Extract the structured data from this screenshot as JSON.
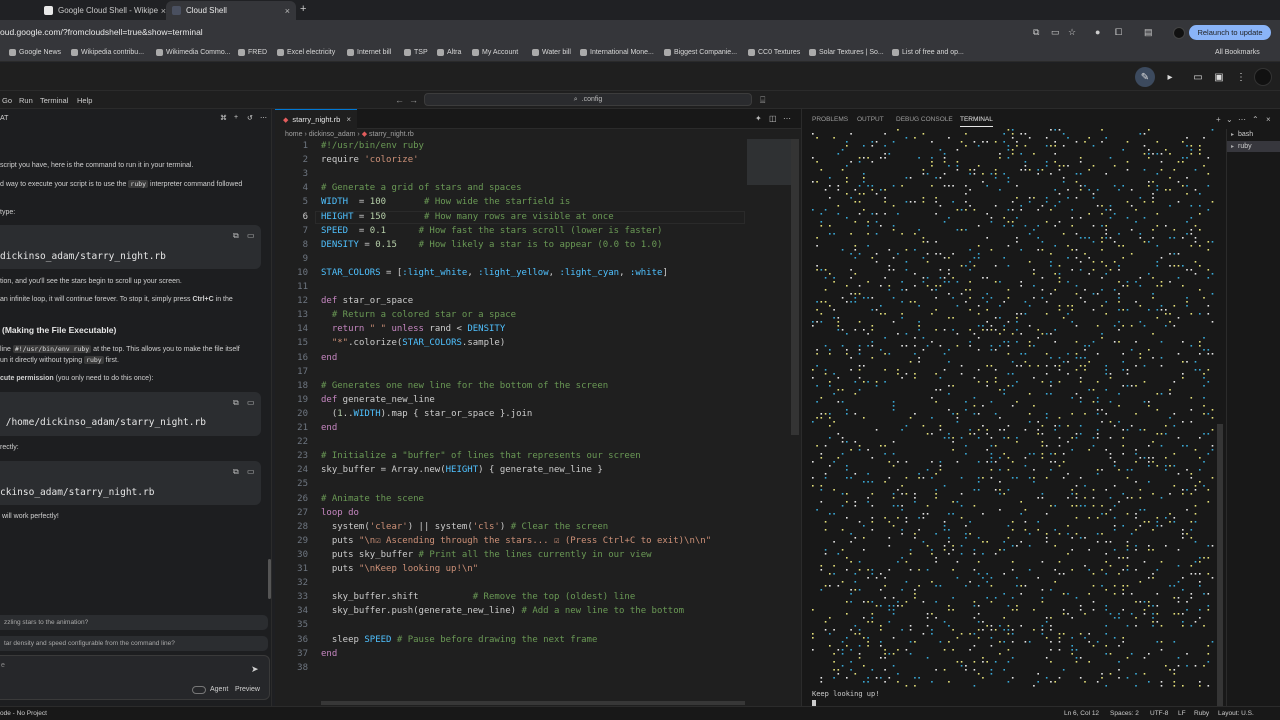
{
  "browser": {
    "tabs": [
      {
        "label": "Google Cloud Shell - Wikipe"
      },
      {
        "label": "Cloud Shell"
      }
    ],
    "url": "oud.google.com/?fromcloudshell=true&show=terminal",
    "relaunch_label": "Relaunch to update",
    "bookmarks": [
      "Google News",
      "Wikipedia contribu...",
      "Wikimedia Commo...",
      "FRED",
      "Excel electricity",
      "Internet bill",
      "TSP",
      "Altra",
      "My Account",
      "Water bill",
      "International Mone...",
      "Biggest Companie...",
      "CC0 Textures",
      "Solar Textures | So...",
      "List of free and op..."
    ],
    "all_bookmarks": "All Bookmarks"
  },
  "menubar": {
    "items": [
      "Go",
      "Run",
      "Terminal",
      "Help"
    ],
    "command_center": ".config"
  },
  "chat": {
    "header": "AT",
    "lines": [
      "script you have, here is the command to run it in your terminal.",
      "d way to execute your script is to use the",
      "interpreter command followed",
      "type:",
      "tion, and you'll see the stars begin to scroll up your screen.",
      "an infinite loop, it will continue forever. To stop it, simply press",
      "Ctrl+C",
      "in the",
      "(Making the File Executable)",
      "line",
      "at the top. This allows you to make the file itself",
      "un it directly without typing",
      "first.",
      "cute permission",
      "(you only need to do this once):",
      "rectly:",
      "will work perfectly!"
    ],
    "inline_codes": [
      "ruby",
      "#!/usr/bin/env ruby",
      "ruby"
    ],
    "code_blocks": [
      "dickinso_adam/starry_night.rb",
      "/home/dickinso_adam/starry_night.rb",
      "ckinso_adam/starry_night.rb"
    ],
    "suggestions": [
      "zzling stars to the animation?",
      "tar density and speed configurable from the command line?"
    ],
    "input_prefix": "e",
    "agent_label": "Agent",
    "preview_label": "Preview"
  },
  "editor": {
    "tab_label": "starry_night.rb",
    "breadcrumb": [
      "home",
      "dickinso_adam",
      "starry_night.rb"
    ],
    "current_line": 6,
    "lines": [
      "#!/usr/bin/env ruby",
      "require 'colorize'",
      "",
      "# Generate a grid of stars and spaces",
      "WIDTH  = 100       # How wide the starfield is",
      "HEIGHT = 150       # How many rows are visible at once",
      "SPEED  = 0.1      # How fast the stars scroll (lower is faster)",
      "DENSITY = 0.15    # How likely a star is to appear (0.0 to 1.0)",
      "",
      "STAR_COLORS = [:light_white, :light_yellow, :light_cyan, :white]",
      "",
      "def star_or_space",
      "  # Return a colored star or a space",
      "  return \" \" unless rand < DENSITY",
      "  \"*\".colorize(STAR_COLORS.sample)",
      "end",
      "",
      "# Generates one new line for the bottom of the screen",
      "def generate_new_line",
      "  (1..WIDTH).map { star_or_space }.join",
      "end",
      "",
      "# Initialize a \"buffer\" of lines that represents our screen",
      "sky_buffer = Array.new(HEIGHT) { generate_new_line }",
      "",
      "# Animate the scene",
      "loop do",
      "  system('clear') || system('cls') # Clear the screen",
      "  puts \"\\n☑ Ascending through the stars... ☑ (Press Ctrl+C to exit)\\n\\n\"",
      "  puts sky_buffer # Print all the lines currently in our view",
      "  puts \"\\nKeep looking up!\\n\"",
      "",
      "  sky_buffer.shift          # Remove the top (oldest) line",
      "  sky_buffer.push(generate_new_line) # Add a new line to the bottom",
      "",
      "  sleep SPEED # Pause before drawing the next frame",
      "end",
      ""
    ]
  },
  "panel": {
    "tabs": [
      "PROBLEMS",
      "OUTPUT",
      "DEBUG CONSOLE",
      "TERMINAL"
    ],
    "terminals": [
      "bash",
      "ruby"
    ],
    "output_last_line": "Keep looking up!",
    "star_colors": [
      "#e6e6e6",
      "#e5e07a",
      "#39a9d6"
    ]
  },
  "status": {
    "left": "ode - No Project",
    "position": "Ln 6, Col 12",
    "spaces": "Spaces: 2",
    "encoding": "UTF-8",
    "eol": "LF",
    "language": "Ruby",
    "layout": "Layout: U.S."
  }
}
